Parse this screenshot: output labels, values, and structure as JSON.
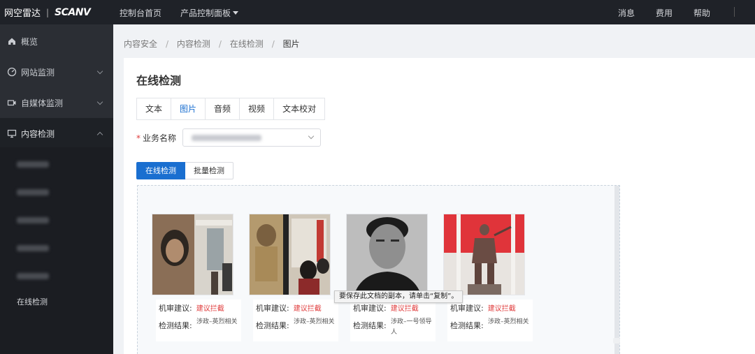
{
  "topbar": {
    "brand_name": "网空雷达",
    "brand_sep": "|",
    "brand_logo": "SCAN",
    "brand_logo_suffix": "V",
    "nav_home": "控制台首页",
    "nav_products": "产品控制面板",
    "nav_messages": "消息",
    "nav_billing": "费用",
    "nav_help": "帮助"
  },
  "sidebar": {
    "overview": "概览",
    "site_monitor": "网站监测",
    "media_monitor": "自媒体监测",
    "content_check": "内容检测",
    "online_check": "在线检测"
  },
  "breadcrumb": [
    "内容安全",
    "内容检测",
    "在线检测",
    "图片"
  ],
  "page": {
    "title": "在线检测",
    "tabs": [
      "文本",
      "图片",
      "音频",
      "视频",
      "文本校对"
    ],
    "active_tab": "图片",
    "field_required_mark": "*",
    "field_label": "业务名称",
    "btn_online": "在线检测",
    "btn_batch": "批量检测"
  },
  "cards": [
    {
      "advice_label": "机审建议:",
      "advice_value": "建议拦截",
      "result_label": "检测结果:",
      "result_value": "涉政–英烈相关"
    },
    {
      "advice_label": "机审建议:",
      "advice_value": "建议拦截",
      "result_label": "检测结果:",
      "result_value": "涉政–英烈相关"
    },
    {
      "advice_label": "机审建议:",
      "advice_value": "建议拦截",
      "result_label": "检测结果:",
      "result_value": "涉政–一号领导人"
    },
    {
      "advice_label": "机审建议:",
      "advice_value": "建议拦截",
      "result_label": "检测结果:",
      "result_value": "涉政–英烈相关"
    }
  ],
  "tooltip": "要保存此文档的副本，请单击“复制”。",
  "colors": {
    "accent": "#1a6fd0",
    "danger": "#e03c3c",
    "topbar": "#1f2228",
    "sidebar": "#2b2e34"
  }
}
